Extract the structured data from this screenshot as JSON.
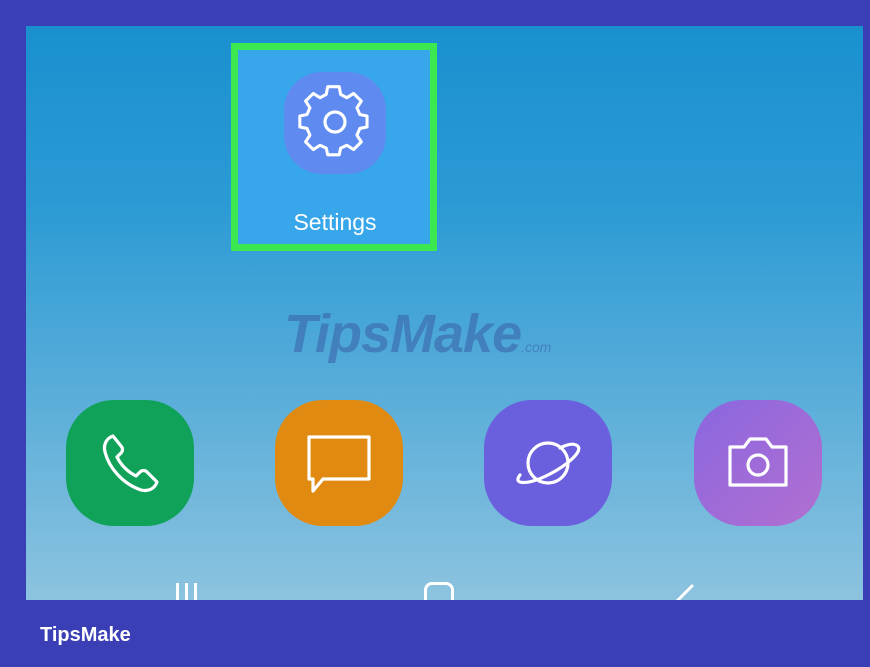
{
  "home_screen": {
    "settings_app": {
      "label": "Settings",
      "icon": "gear-icon",
      "highlight_color": "#3be84f",
      "icon_bg": "#5f8bf1"
    },
    "watermark": {
      "main": "TipsMake",
      "suffix": ".com"
    },
    "dock": [
      {
        "name": "phone",
        "icon": "phone-icon",
        "color": "#11a25a"
      },
      {
        "name": "messages",
        "icon": "message-icon",
        "color": "#e18a12"
      },
      {
        "name": "internet",
        "icon": "planet-icon",
        "color": "#6a5fdd"
      },
      {
        "name": "camera",
        "icon": "camera-icon",
        "color": "#9a6bdb"
      }
    ],
    "nav_bar": [
      "recent-apps-icon",
      "home-icon",
      "back-icon"
    ]
  },
  "footer": {
    "brand": "TipsMake"
  },
  "colors": {
    "frame": "#3b3fb6",
    "screen_top": "#1a90cf",
    "screen_bottom": "#8cc3df"
  }
}
